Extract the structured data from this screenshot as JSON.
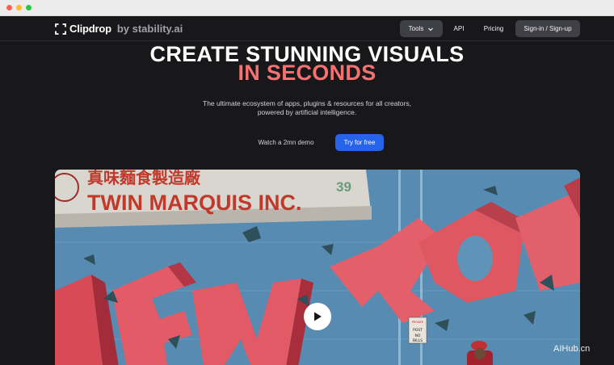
{
  "window": {
    "chrome_dots": [
      "close",
      "minimize",
      "maximize"
    ]
  },
  "nav": {
    "brand": "Clipdrop",
    "brand_sub": "by stability.ai",
    "tools_label": "Tools",
    "api_label": "API",
    "pricing_label": "Pricing",
    "signin_label": "Sign-in / Sign-up"
  },
  "hero": {
    "title_line1": "CREATE STUNNING VISUALS",
    "title_line2": "IN SECONDS",
    "subtitle_line1": "The ultimate ecosystem of apps, plugins & resources for all creators,",
    "subtitle_line2": "powered by artificial intelligence.",
    "demo_label": "Watch a 2mn demo",
    "cta_label": "Try for free"
  },
  "video": {
    "sign_chinese": "真味麵食製造廠",
    "sign_text": "TWIN MARQUIS INC.",
    "sign_number": "39",
    "graffiti_text": "NEW YORK",
    "small_sign": "PRIVATE PROPERTY POST NO BILLS"
  },
  "watermark": "AIHub.cn",
  "colors": {
    "background": "#18181b",
    "accent_red": "#f87171",
    "cta_blue": "#2563eb"
  }
}
